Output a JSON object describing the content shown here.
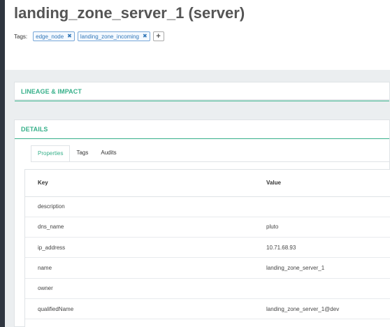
{
  "entity": {
    "title": "landing_zone_server_1 (server)"
  },
  "tags": {
    "label": "Tags:",
    "items": [
      {
        "text": "edge_node"
      },
      {
        "text": "landing_zone_incoming"
      }
    ],
    "remove_glyph": "✖",
    "add_glyph": "+"
  },
  "lineage": {
    "title": "LINEAGE & IMPACT"
  },
  "details": {
    "title": "DETAILS",
    "tabs": [
      {
        "label": "Properties",
        "active": true
      },
      {
        "label": "Tags",
        "active": false
      },
      {
        "label": "Audits",
        "active": false
      }
    ],
    "table": {
      "columns": [
        "Key",
        "Value"
      ],
      "rows": [
        {
          "key": "description",
          "value": ""
        },
        {
          "key": "dns_name",
          "value": "pluto"
        },
        {
          "key": "ip_address",
          "value": "10.71.68.93"
        },
        {
          "key": "name",
          "value": "landing_zone_server_1"
        },
        {
          "key": "owner",
          "value": ""
        },
        {
          "key": "qualifiedName",
          "value": "landing_zone_server_1@dev"
        }
      ]
    }
  },
  "colors": {
    "accent": "#37b08a",
    "tag_border": "#79a8d8",
    "tag_text": "#3378b8"
  },
  "icons": {
    "tag_remove": "close-icon",
    "tag_add": "plus-icon"
  }
}
